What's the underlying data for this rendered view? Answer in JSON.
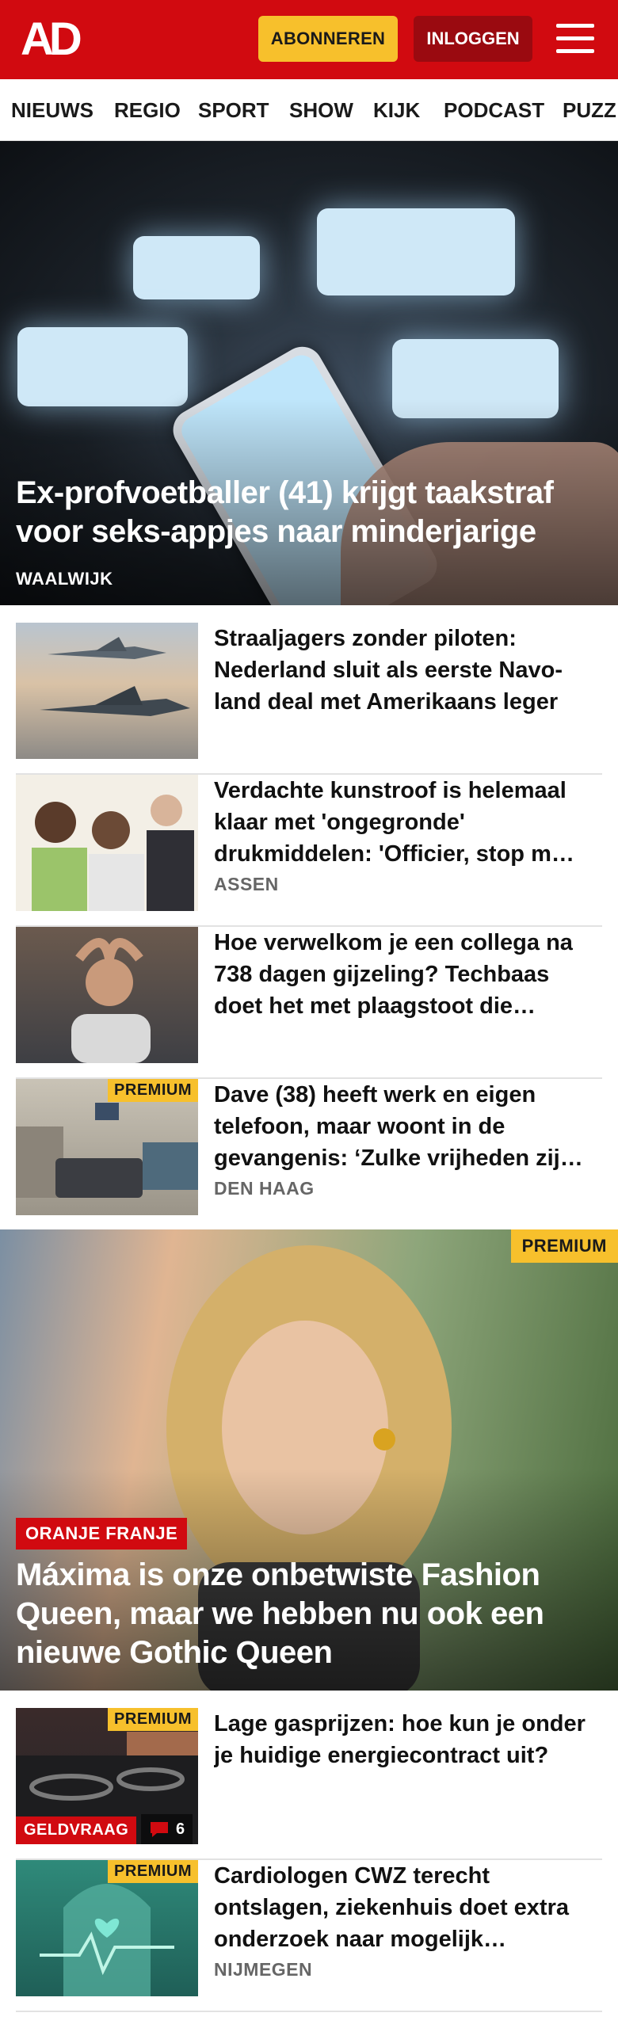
{
  "header": {
    "logo": "AD",
    "subscribe_label": "ABONNEREN",
    "login_label": "INLOGGEN"
  },
  "nav": {
    "items": [
      "NIEUWS",
      "REGIO",
      "SPORT",
      "SHOW",
      "KIJK",
      "PODCAST",
      "PUZZ"
    ]
  },
  "hero": {
    "title": "Ex-profvoetballer (41) krijgt taakstraf voor seks-appjes naar minderjarige",
    "tag": "WAALWIJK"
  },
  "articles": [
    {
      "title": "Straaljagers zonder piloten: Nederland sluit als eerste Navo-land deal met Amerikaans leger",
      "tag": ""
    },
    {
      "title": "Verdachte kunstroof is helemaal klaar met 'ongegronde' drukmiddelen: 'Officier, stop m…",
      "tag": "ASSEN"
    },
    {
      "title": "Hoe verwelkom je een collega na 738 dagen gijzeling? Techbaas doet het met plaagstoot die…",
      "tag": ""
    },
    {
      "title": "Dave (38) heeft werk en eigen telefoon, maar woont in de gevangenis: ‘Zulke vrijheden zij…",
      "tag": "DEN HAAG",
      "premium": "PREMIUM"
    }
  ],
  "feature": {
    "premium": "PREMIUM",
    "label": "ORANJE FRANJE",
    "title": "Máxima is onze onbetwiste Fashion Queen, maar we hebben nu ook een nieuwe Gothic Queen"
  },
  "articles2": [
    {
      "title": "Lage gasprijzen: hoe kun je onder je huidige energiecontract uit?",
      "premium": "PREMIUM",
      "label": "GELDVRAAG",
      "comments": "6"
    },
    {
      "title": "Cardiologen CWZ terecht ontslagen, ziekenhuis doet extra onderzoek naar mogelijk…",
      "premium": "PREMIUM",
      "tag": "NIJMEGEN"
    }
  ],
  "colors": {
    "brand_red": "#d10a10",
    "premium_yellow": "#f7c02c",
    "login_dark_red": "#9a0a10"
  }
}
